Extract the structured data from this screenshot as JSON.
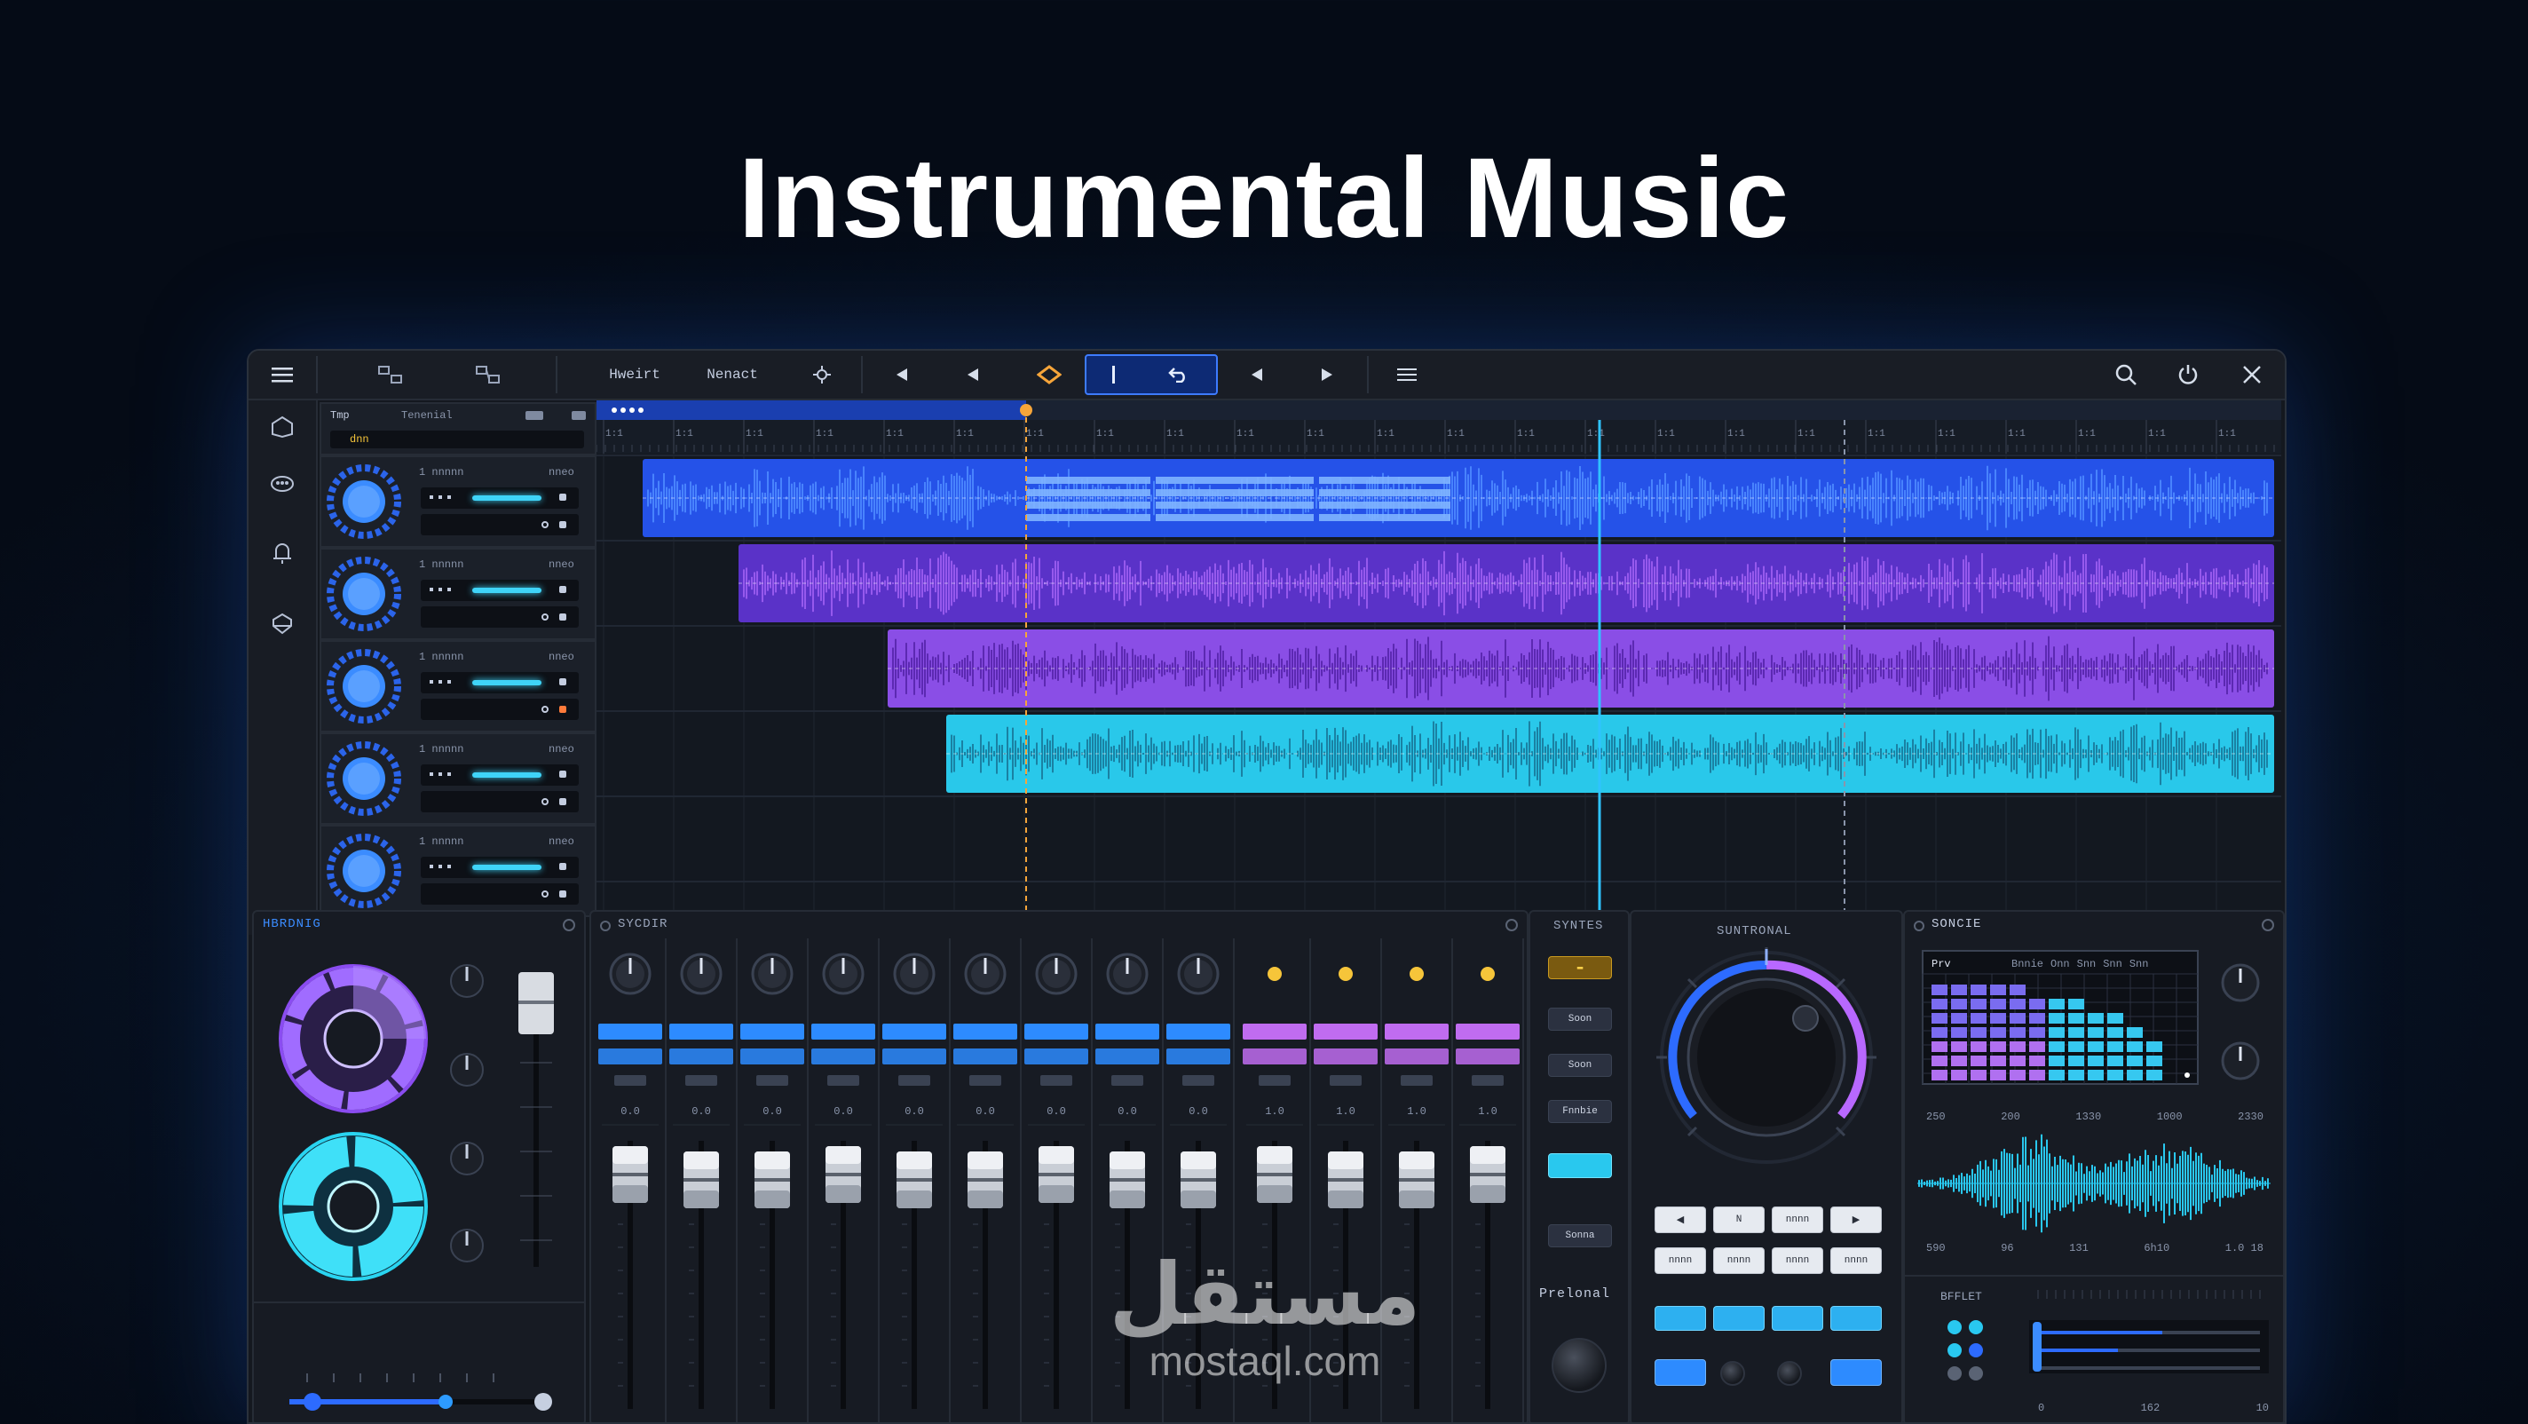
{
  "page": {
    "title": "Instrumental Music"
  },
  "toolbar": {
    "label_1": "Hweirt",
    "label_2": "Nenact",
    "icons": [
      "menu-icon",
      "grid-icon",
      "grid-alt-icon",
      "settings-icon",
      "rewind-icon",
      "back-icon",
      "loop-marker-icon",
      "cursor-icon",
      "undo-icon",
      "prev-icon",
      "play-icon",
      "list-icon",
      "search-icon",
      "power-icon",
      "close-icon"
    ]
  },
  "left_nav": {
    "icons": [
      "home-icon",
      "group-icon",
      "bell-icon",
      "shield-icon"
    ]
  },
  "track_header": {
    "label_1": "Tmp",
    "label_2": "Tenenial",
    "value": "dnn"
  },
  "tracks": [
    {
      "name": "1 nnnnn",
      "value": "nneo",
      "accent": "#3b8cff",
      "clip_color": "#2d5cf0"
    },
    {
      "name": "1 nnnnn",
      "value": "nneo",
      "accent": "#3b8cff",
      "clip_color": "#6a3ee0"
    },
    {
      "name": "1 nnnnn",
      "value": "nneo",
      "accent": "#3b8cff",
      "clip_color": "#9a5cf0"
    },
    {
      "name": "1 nnnnn",
      "value": "nneo",
      "accent": "#3b8cff",
      "clip_color": "#2fd0ee"
    },
    {
      "name": "1 nnnnn",
      "value": "nneo",
      "accent": "#3b8cff",
      "clip_color": ""
    }
  ],
  "panels": {
    "left": {
      "title": "HBRDNIG"
    },
    "mixer": {
      "title": "SYCDIR",
      "channel_labels": [
        "0.0",
        "0.0",
        "0.0",
        "0.0",
        "0.0",
        "0.0",
        "0.0",
        "0.0",
        "0.0",
        "1.0",
        "1.0",
        "1.0",
        "1.0"
      ]
    },
    "sends": {
      "title": "SYNTES",
      "buttons": [
        "Soon",
        "Soon",
        "Fnnbie",
        "Sonna"
      ]
    },
    "synth": {
      "title": "SUNTRONAL",
      "buttons": [
        "◀",
        "N",
        "nnnn",
        "▶",
        "nnnn",
        "nnnn",
        "nnnn",
        "nnnn"
      ],
      "label": "Prelonal"
    },
    "fx": {
      "title": "SONCIE",
      "grid_label": "Prv",
      "grid_cols": [
        "Bnnie",
        "Onn",
        "Snn",
        "Snn",
        "Snn"
      ],
      "wave_labels_top": [
        "250",
        "200",
        "1330",
        "1000",
        "2330"
      ],
      "wave_labels_bottom": [
        "590",
        "96",
        "131",
        "6h10",
        "1.0 18"
      ],
      "effect_title": "BFFLET",
      "slider_labels": [
        "0",
        "162",
        "10"
      ]
    }
  },
  "colors": {
    "accent_blue": "#2d6bff",
    "purple": "#8a4cf0",
    "cyan": "#29d4f0",
    "playhead": "#2fc3ff",
    "marker": "#f6a53a"
  },
  "watermark": {
    "arabic": "مستقل",
    "latin": "mostaql.com"
  }
}
